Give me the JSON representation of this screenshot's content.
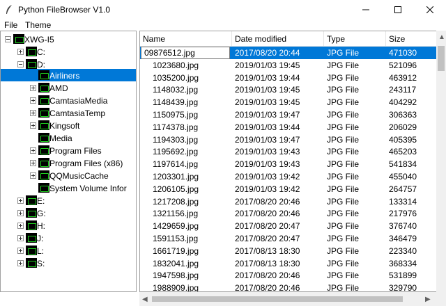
{
  "window": {
    "title": "Python FileBrowser V1.0"
  },
  "menu": {
    "file": "File",
    "theme": "Theme"
  },
  "tree": {
    "root": "XWG-I5",
    "drives": {
      "c": "C:",
      "d": "D:",
      "e": "E:",
      "g": "G:",
      "h": "H:",
      "j": "J:",
      "l": "L:",
      "s": "S:"
    },
    "folders": {
      "airliners": "Airliners",
      "amd": "AMD",
      "camtasiamedia": "CamtasiaMedia",
      "camtasiatemp": "CamtasiaTemp",
      "kingsoft": "Kingsoft",
      "media": "Media",
      "program_files": "Program Files",
      "program_files_x86": "Program Files (x86)",
      "qqmusiccache": "QQMusicCache",
      "sysvol": "System Volume Infor"
    }
  },
  "list": {
    "columns": {
      "name": "Name",
      "date": "Date modified",
      "type": "Type",
      "size": "Size"
    },
    "rows": [
      {
        "name": "09876512.jpg",
        "date": "2017/08/20 20:44",
        "type": "JPG File",
        "size": "471030"
      },
      {
        "name": "1023680.jpg",
        "date": "2019/01/03 19:45",
        "type": "JPG File",
        "size": "521096"
      },
      {
        "name": "1035200.jpg",
        "date": "2019/01/03 19:44",
        "type": "JPG File",
        "size": "463912"
      },
      {
        "name": "1148032.jpg",
        "date": "2019/01/03 19:45",
        "type": "JPG File",
        "size": "243117"
      },
      {
        "name": "1148439.jpg",
        "date": "2019/01/03 19:45",
        "type": "JPG File",
        "size": "404292"
      },
      {
        "name": "1150975.jpg",
        "date": "2019/01/03 19:47",
        "type": "JPG File",
        "size": "306363"
      },
      {
        "name": "1174378.jpg",
        "date": "2019/01/03 19:44",
        "type": "JPG File",
        "size": "206029"
      },
      {
        "name": "1194303.jpg",
        "date": "2019/01/03 19:47",
        "type": "JPG File",
        "size": "405395"
      },
      {
        "name": "1195692.jpg",
        "date": "2019/01/03 19:43",
        "type": "JPG File",
        "size": "465203"
      },
      {
        "name": "1197614.jpg",
        "date": "2019/01/03 19:43",
        "type": "JPG File",
        "size": "541834"
      },
      {
        "name": "1203301.jpg",
        "date": "2019/01/03 19:42",
        "type": "JPG File",
        "size": "455040"
      },
      {
        "name": "1206105.jpg",
        "date": "2019/01/03 19:42",
        "type": "JPG File",
        "size": "264757"
      },
      {
        "name": "1217208.jpg",
        "date": "2017/08/20 20:46",
        "type": "JPG File",
        "size": "133314"
      },
      {
        "name": "1321156.jpg",
        "date": "2017/08/20 20:46",
        "type": "JPG File",
        "size": "217976"
      },
      {
        "name": "1429659.jpg",
        "date": "2017/08/20 20:47",
        "type": "JPG File",
        "size": "376740"
      },
      {
        "name": "1591153.jpg",
        "date": "2017/08/20 20:47",
        "type": "JPG File",
        "size": "346479"
      },
      {
        "name": "1661719.jpg",
        "date": "2017/08/13 18:30",
        "type": "JPG File",
        "size": "223340"
      },
      {
        "name": "1832041.jpg",
        "date": "2017/08/13 18:30",
        "type": "JPG File",
        "size": "368334"
      },
      {
        "name": "1947598.jpg",
        "date": "2017/08/20 20:46",
        "type": "JPG File",
        "size": "531899"
      },
      {
        "name": "1988909.jpg",
        "date": "2017/08/20 20:46",
        "type": "JPG File",
        "size": "329790"
      }
    ]
  },
  "colors": {
    "selection": "#0078d7",
    "drive_icon_green": "#1fd11f"
  },
  "icons": {
    "app": "feather-icon",
    "minimize": "minimize-icon",
    "maximize": "maximize-icon",
    "close": "close-icon"
  }
}
